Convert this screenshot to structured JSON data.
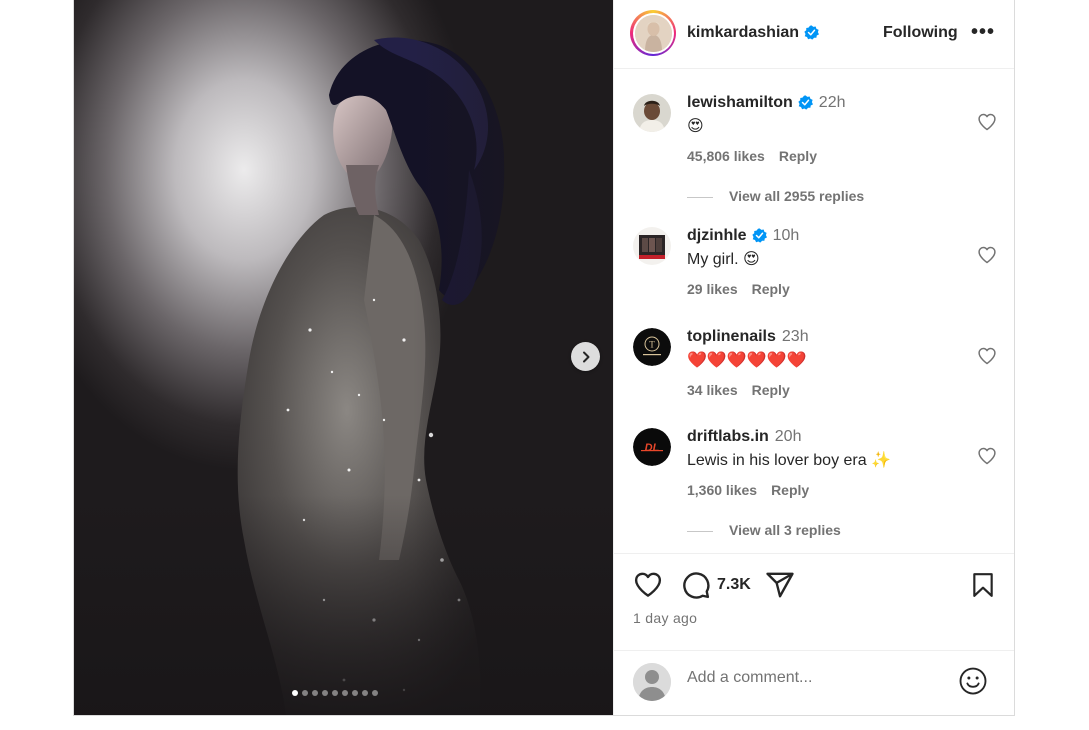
{
  "post": {
    "author": "kimkardashian",
    "follow_state": "Following",
    "more_glyph": "•••",
    "carousel_count": 9,
    "carousel_active": 0
  },
  "comments": [
    {
      "user": "lewishamilton",
      "verified": true,
      "time": "22h",
      "text": "😍",
      "likes": "45,806 likes",
      "reply": "Reply",
      "view_replies": "View all 2955 replies"
    },
    {
      "user": "djzinhle",
      "verified": true,
      "time": "10h",
      "text": "My girl. 😍",
      "likes": "29 likes",
      "reply": "Reply"
    },
    {
      "user": "toplinenails",
      "verified": false,
      "time": "23h",
      "text": "❤️❤️❤️❤️❤️❤️",
      "likes": "34 likes",
      "reply": "Reply"
    },
    {
      "user": "driftlabs.in",
      "verified": false,
      "time": "20h",
      "text": "Lewis in his lover boy era ✨",
      "likes": "1,360 likes",
      "reply": "Reply",
      "view_replies": "View all 3 replies"
    }
  ],
  "actions": {
    "comment_count": "7.3K",
    "posted": "1 day ago"
  },
  "composer": {
    "placeholder": "Add a comment..."
  },
  "icons": {
    "verified": "verified-badge-icon",
    "heart": "heart-icon",
    "comment": "comment-bubble-icon",
    "share": "paper-plane-icon",
    "save": "bookmark-icon",
    "emoji": "smiley-icon",
    "next": "chevron-right-icon"
  },
  "colors": {
    "verified_blue": "#0095f6",
    "heart_red": "#ed4956",
    "text_primary": "#262626",
    "text_secondary": "#737373"
  }
}
